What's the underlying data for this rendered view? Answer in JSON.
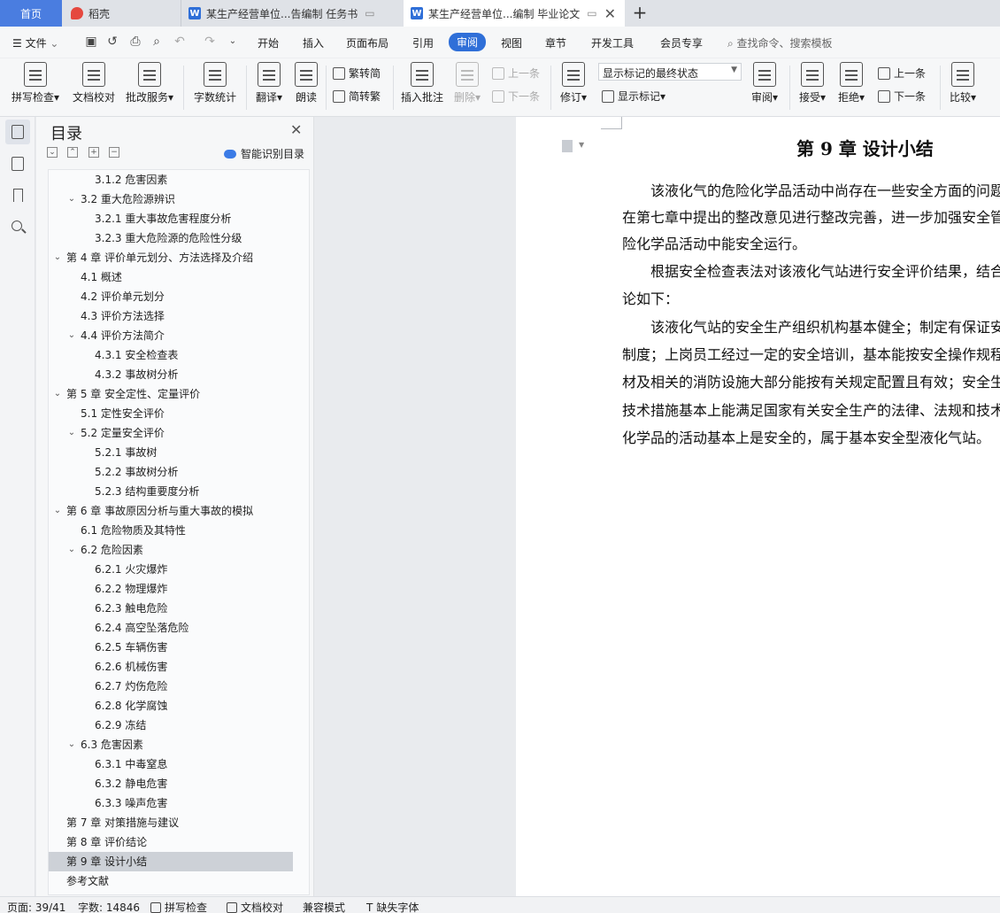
{
  "tabs": {
    "home": "首页",
    "daoke": "稻壳",
    "doc1": "某生产经营单位...告编制 任务书",
    "doc2": "某生产经营单位...编制 毕业论文"
  },
  "menu": {
    "file": "文件",
    "items": [
      "开始",
      "插入",
      "页面布局",
      "引用",
      "审阅",
      "视图",
      "章节",
      "开发工具",
      "会员专享"
    ],
    "search": "查找命令、搜索模板"
  },
  "ribbon": {
    "spell": "拼写检查",
    "proof": "文档校对",
    "review_service": "批改服务",
    "word_count": "字数统计",
    "translate": "翻译",
    "read_aloud": "朗读",
    "to_traditional": "繁转简",
    "to_simplified": "简转繁",
    "insert_comment": "插入批注",
    "delete": "删除",
    "prev_comment": "上一条",
    "next_comment": "下一条",
    "track": "修订",
    "mark_state": "显示标记的最终状态",
    "show_marks": "显示标记",
    "review": "审阅",
    "accept": "接受",
    "reject": "拒绝",
    "prev_change": "上一条",
    "next_change": "下一条",
    "compare": "比较"
  },
  "toc": {
    "title": "目录",
    "smart": "智能识别目录",
    "items": [
      "3.1.2 危害因素",
      "3.2 重大危险源辨识",
      "3.2.1 重大事故危害程度分析",
      "3.2.3 重大危险源的危险性分级",
      "第 4 章 评价单元划分、方法选择及介绍",
      "4.1 概述",
      "4.2 评价单元划分",
      "4.3 评价方法选择",
      "4.4 评价方法简介",
      "4.3.1 安全检查表",
      "4.3.2 事故树分析",
      "第 5 章 安全定性、定量评价",
      "5.1 定性安全评价",
      "5.2 定量安全评价",
      "5.2.1 事故树",
      "5.2.2 事故树分析",
      "5.2.3 结构重要度分析",
      "第 6 章 事故原因分析与重大事故的模拟",
      "6.1 危险物质及其特性",
      "6.2 危险因素",
      "6.2.1 火灾爆炸",
      "6.2.2 物理爆炸",
      "6.2.3 触电危险",
      "6.2.4 高空坠落危险",
      "6.2.5 车辆伤害",
      "6.2.6 机械伤害",
      "6.2.7 灼伤危险",
      "6.2.8 化学腐蚀",
      "6.2.9 冻结",
      "6.3 危害因素",
      "6.3.1 中毒窒息",
      "6.3.2 静电危害",
      "6.3.3 噪声危害",
      "第 7 章 对策措施与建议",
      "第 8 章 评价结论",
      "第 9 章 设计小结",
      "参考文献"
    ]
  },
  "document": {
    "chapter_title": "第 9 章  设计小结",
    "lines": [
      "该液化气的危险化学品活动中尚存在一些安全方面的问题",
      "在第七章中提出的整改意见进行整改完善，进一步加强安全管",
      "险化学品活动中能安全运行。",
      "根据安全检查表法对该液化气站进行安全评价结果，结合",
      "论如下：",
      "该液化气站的安全生产组织机构基本健全；制定有保证安",
      "制度；上岗员工经过一定的安全培训，基本能按安全操作规程",
      "材及相关的消防设施大部分能按有关规定配置且有效；安全生",
      "技术措施基本上能满足国家有关安全生产的法律、法规和技术",
      "化学品的活动基本上是安全的，属于基本安全型液化气站。"
    ]
  },
  "status": {
    "page": "页面: 39/41",
    "words": "字数: 14846",
    "spell": "拼写检查",
    "proof": "文档校对",
    "compat": "兼容模式",
    "missing_font": "缺失字体"
  }
}
